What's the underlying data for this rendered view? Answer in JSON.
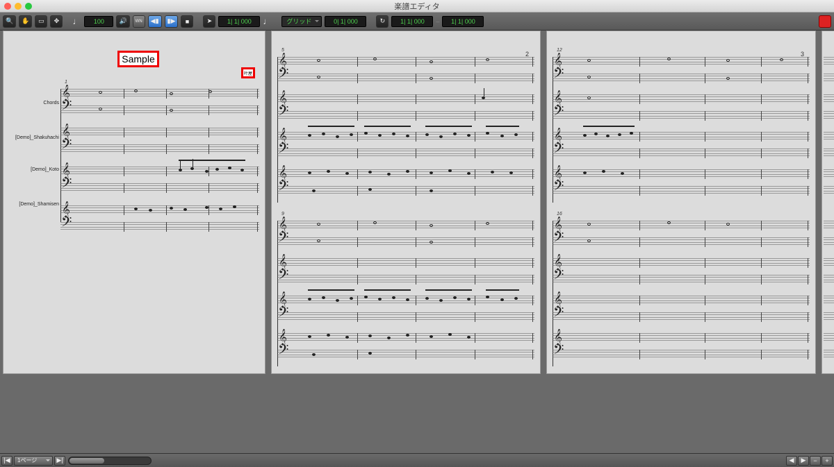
{
  "window": {
    "title": "楽譜エディタ"
  },
  "toolbar": {
    "tempo": "100",
    "cursor_pos": "1| 1| 000",
    "grid_label": "グリッド",
    "grid_value": "0| 1| 000",
    "loop_start": "1| 1| 000",
    "loop_end": "1| 1| 000",
    "note_value": "♩"
  },
  "score": {
    "title": "Sample",
    "subtitle": "叶屋",
    "tracks": [
      {
        "name": "Chords"
      },
      {
        "name": "[Demo]_Shakuhachi"
      },
      {
        "name": "[Demo]_Koto"
      },
      {
        "name": "[Demo]_Shamisen"
      }
    ],
    "pages": [
      {
        "number": "",
        "first_measure": "1"
      },
      {
        "number": "2",
        "first_measure_top": "5",
        "first_measure_bottom": "9"
      },
      {
        "number": "3",
        "first_measure_top": "12",
        "first_measure_bottom": "16"
      }
    ]
  },
  "footer": {
    "page_select": "1ページ"
  }
}
